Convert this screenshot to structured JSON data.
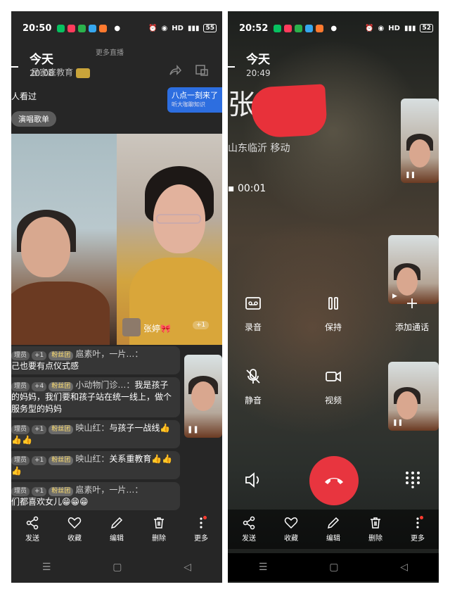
{
  "left": {
    "status": {
      "time": "20:50",
      "battery": "55"
    },
    "header": {
      "title": "今天",
      "date": "20:08"
    },
    "live": {
      "more_live": "更多直播",
      "channel": "是家庭教育",
      "viewed": "人看过",
      "sing_list": "演唱歌单",
      "promo_title": "八点一刻来了",
      "promo_sub": "听大咖聊知识",
      "streamer_name": "张婷🎀",
      "guest_count": "+1",
      "comments": [
        {
          "role": "理员",
          "level": "+1",
          "fan": "粉丝团",
          "name": "扈素叶，一片…：",
          "text": "己也要有点仪式感"
        },
        {
          "role": "理员",
          "level": "+4",
          "fan": "粉丝团",
          "name": "小动物门诊…：",
          "text": "我是孩子的妈妈，我们要和孩子站在统一线上，做个服务型的妈妈"
        },
        {
          "role": "理员",
          "level": "+1",
          "fan": "粉丝团",
          "name": "映山红：",
          "text": "与孩子一战线👍👍👍"
        },
        {
          "role": "理员",
          "level": "+1",
          "fan": "粉丝团",
          "name": "映山红：",
          "text": "关系重教育👍👍👍"
        },
        {
          "role": "理员",
          "level": "+1",
          "fan": "粉丝团",
          "name": "扈素叶，一片…：",
          "text": "们都喜欢女儿😁😁😁"
        }
      ]
    },
    "toolbar": [
      "发送",
      "收藏",
      "编辑",
      "删除",
      "更多"
    ]
  },
  "right": {
    "status": {
      "time": "20:52",
      "battery": "52"
    },
    "header": {
      "title": "今天",
      "date": "20:49"
    },
    "call": {
      "name": "张",
      "location": "山东临沂 移动",
      "duration": "00:01"
    },
    "controls": {
      "record": "录音",
      "hold": "保持",
      "add_call": "添加通话",
      "mute": "静音",
      "video": "视频"
    },
    "toolbar": [
      "发送",
      "收藏",
      "编辑",
      "删除",
      "更多"
    ]
  },
  "colors": {
    "accent_blue": "#2d6ee0",
    "hangup_red": "#e8353f",
    "redaction_red": "#e8313a"
  }
}
